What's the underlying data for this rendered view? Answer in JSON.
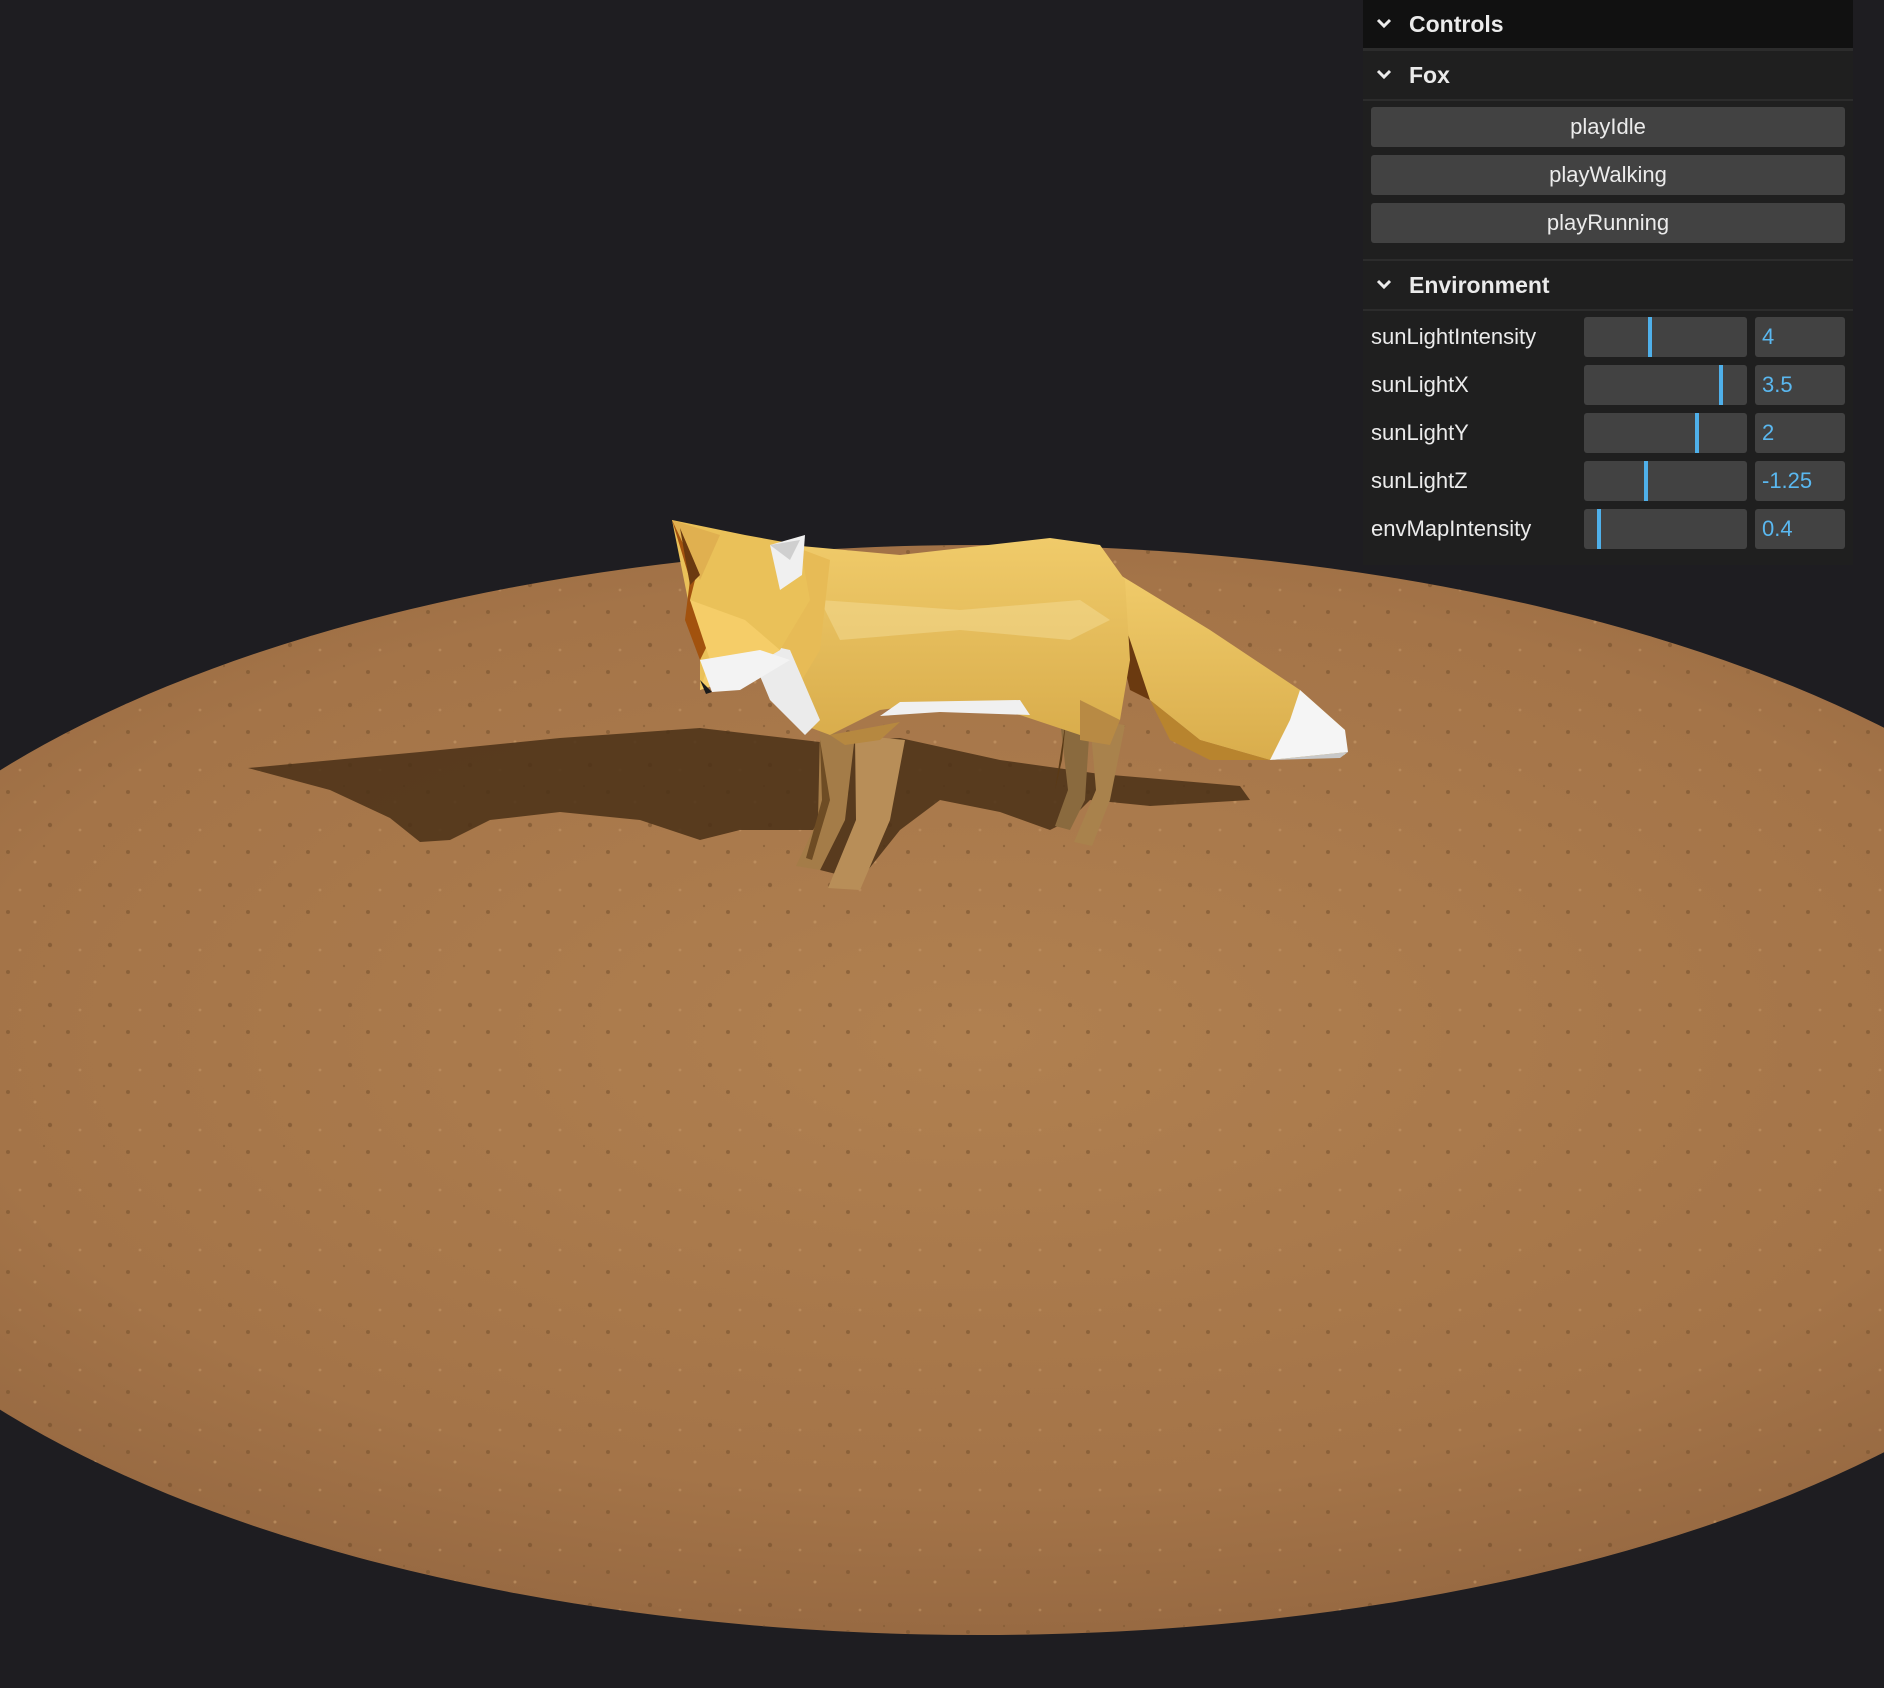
{
  "gui": {
    "title": "Controls",
    "folders": [
      {
        "title": "Fox",
        "buttons": [
          "playIdle",
          "playWalking",
          "playRunning"
        ]
      },
      {
        "title": "Environment",
        "sliders": [
          {
            "label": "sunLightIntensity",
            "value": "4",
            "fraction": 0.4
          },
          {
            "label": "sunLightX",
            "value": "3.5",
            "fraction": 0.85
          },
          {
            "label": "sunLightY",
            "value": "2",
            "fraction": 0.7
          },
          {
            "label": "sunLightZ",
            "value": "-1.25",
            "fraction": 0.375
          },
          {
            "label": "envMapIntensity",
            "value": "0.4",
            "fraction": 0.08
          }
        ]
      }
    ]
  },
  "scene": {
    "background_color": "#1e1d21",
    "ground_color": "#a97a4c",
    "fox_color": "#e8bd5a",
    "accent_color": "#5ab8f0"
  }
}
